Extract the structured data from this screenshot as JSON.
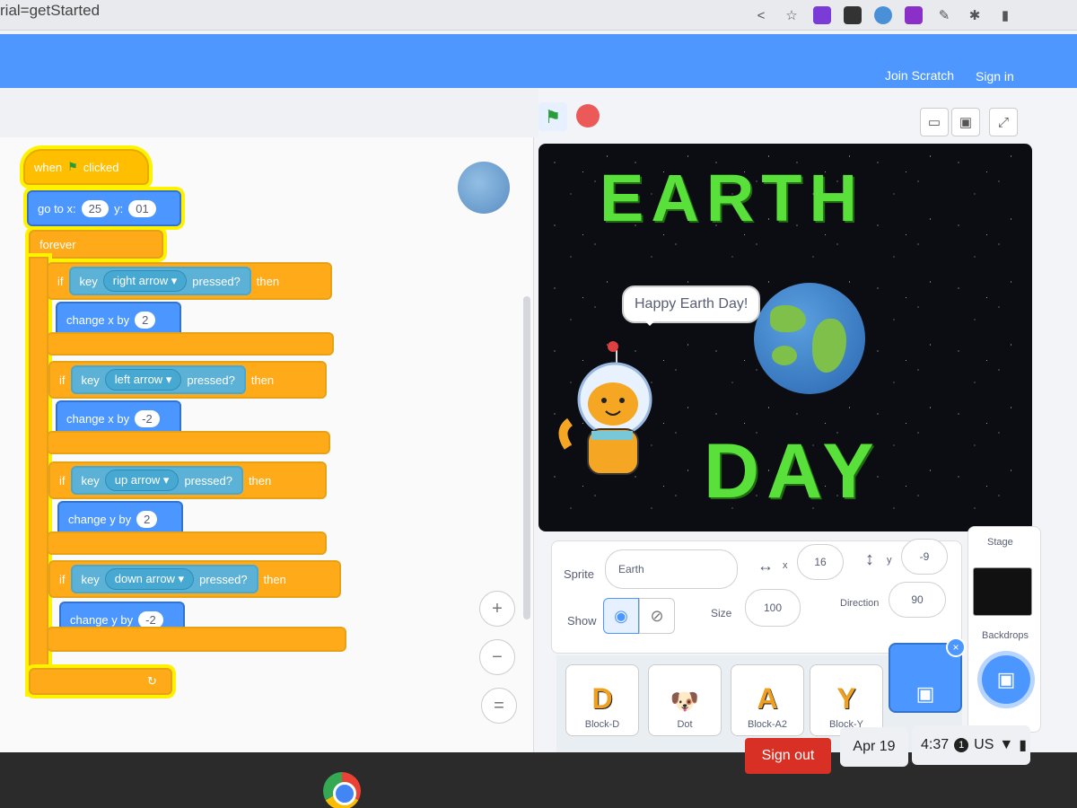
{
  "browser": {
    "url_fragment": "rial=getStarted",
    "icons": [
      "share-icon",
      "star-icon",
      "extension-icon",
      "puzzle-icon",
      "sidebar-icon",
      "menu-icon"
    ]
  },
  "header": {
    "join": "Join Scratch",
    "signin": "Sign in"
  },
  "blocks": {
    "when_clicked": "when",
    "clicked": "clicked",
    "goto": "go to x:",
    "goto_x": "25",
    "goto_y_label": "y:",
    "goto_y": "01",
    "forever": "forever",
    "if_label": "if",
    "key_label": "key",
    "pressed": "pressed?",
    "then": "then",
    "rows": [
      {
        "key": "right arrow",
        "action": "change x by",
        "value": "2"
      },
      {
        "key": "left arrow",
        "action": "change x by",
        "value": "-2"
      },
      {
        "key": "up arrow",
        "action": "change y by",
        "value": "2"
      },
      {
        "key": "down arrow",
        "action": "change y by",
        "value": "-2"
      }
    ]
  },
  "zoom": {
    "in": "+",
    "out": "−",
    "reset": "="
  },
  "stage": {
    "title_top": [
      "E",
      "A",
      "R",
      "T",
      "H"
    ],
    "title_bottom": [
      "D",
      "A",
      "Y"
    ],
    "bubble": "Happy Earth Day!"
  },
  "sprite_info": {
    "sprite_label": "Sprite",
    "sprite_name": "Earth",
    "x_label": "x",
    "x_value": "16",
    "y_label": "y",
    "y_value": "-9",
    "show_label": "Show",
    "size_label": "Size",
    "size_value": "100",
    "direction_label": "Direction",
    "direction_value": "90"
  },
  "sprites": [
    {
      "name": "Block-D",
      "glyph": "D",
      "color": "#f0a020"
    },
    {
      "name": "Dot",
      "glyph": "🐶",
      "color": "#f0a020"
    },
    {
      "name": "Block-A2",
      "glyph": "A",
      "color": "#f0a020"
    },
    {
      "name": "Block-Y",
      "glyph": "Y",
      "color": "#f0a020"
    }
  ],
  "stage_pane": {
    "title": "Stage",
    "backdrops": "Backdrops"
  },
  "taskbar": {
    "signout": "Sign out",
    "date": "Apr 19",
    "time": "4:37",
    "notif": "1",
    "locale": "US"
  }
}
